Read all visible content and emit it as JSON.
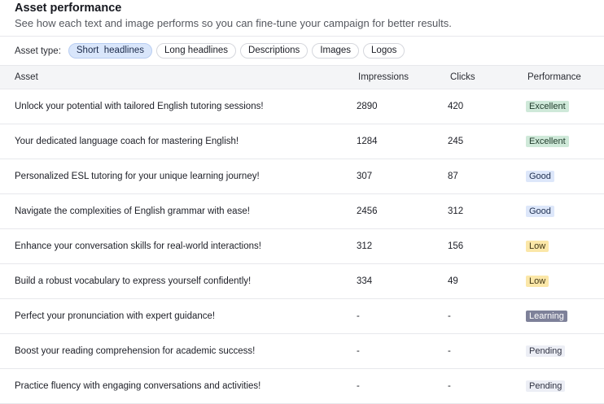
{
  "header": {
    "title": "Asset performance",
    "subtitle": "See how each text and image performs so you can fine-tune your campaign for better results."
  },
  "filters": {
    "label": "Asset type:",
    "options": [
      "Short  headlines",
      "Long headlines",
      "Descriptions",
      "Images",
      "Logos"
    ],
    "selected_index": 0
  },
  "table": {
    "columns": [
      "Asset",
      "Impressions",
      "Clicks",
      "Performance"
    ],
    "rows": [
      {
        "asset": "Unlock your potential with tailored English tutoring sessions!",
        "impressions": "2890",
        "clicks": "420",
        "performance": "Excellent"
      },
      {
        "asset": "Your dedicated language coach for mastering English!",
        "impressions": "1284",
        "clicks": "245",
        "performance": "Excellent"
      },
      {
        "asset": "Personalized ESL tutoring for your unique learning journey!",
        "impressions": "307",
        "clicks": "87",
        "performance": "Good"
      },
      {
        "asset": "Navigate the complexities of English grammar with ease!",
        "impressions": "2456",
        "clicks": "312",
        "performance": "Good"
      },
      {
        "asset": "Enhance your conversation skills for real-world interactions!",
        "impressions": "312",
        "clicks": "156",
        "performance": "Low"
      },
      {
        "asset": "Build a robust vocabulary to express yourself confidently!",
        "impressions": "334",
        "clicks": "49",
        "performance": "Low"
      },
      {
        "asset": "Perfect your pronunciation with expert guidance!",
        "impressions": "-",
        "clicks": "-",
        "performance": "Learning"
      },
      {
        "asset": "Boost your reading comprehension for academic success!",
        "impressions": "-",
        "clicks": "-",
        "performance": "Pending"
      },
      {
        "asset": "Practice fluency with engaging conversations and activities!",
        "impressions": "-",
        "clicks": "-",
        "performance": "Pending"
      }
    ]
  },
  "colors": {
    "excellent": "#cfe9d9",
    "good": "#dde7fa",
    "low": "#fbe7a8",
    "learning": "#7e8199",
    "pending": "#eceef5",
    "chip_active": "#d9e6fb"
  }
}
